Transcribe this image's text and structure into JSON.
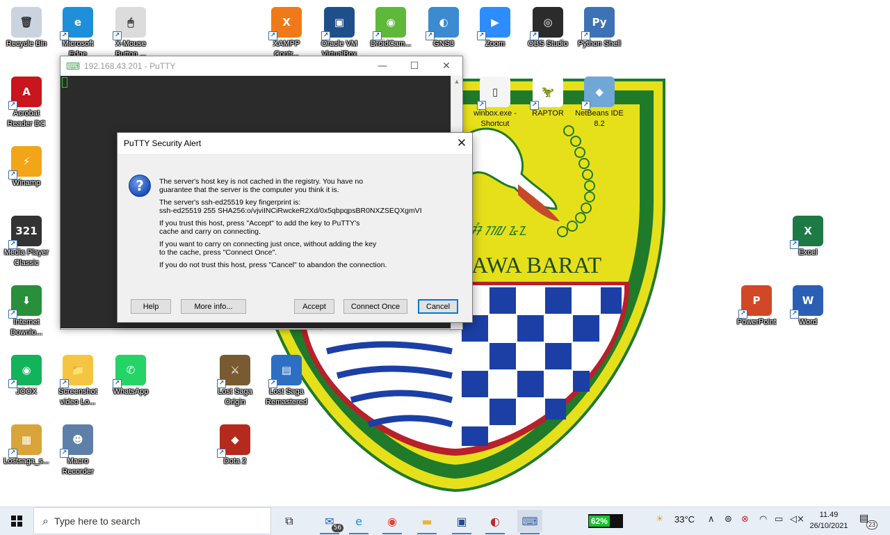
{
  "desktop_icons": [
    {
      "id": "recycle-bin",
      "label": "Recycle Bin",
      "glyph": "🗑",
      "color": "#c9d4de"
    },
    {
      "id": "microsoft-edge",
      "label": "Microsoft Edge",
      "glyph": "e",
      "color": "#1e8fd8"
    },
    {
      "id": "x-mouse",
      "label": "X-Mouse Button ...",
      "glyph": "🖱",
      "color": "#dcdcdc"
    },
    {
      "id": "xampp",
      "label": "XAMPP Contr...",
      "glyph": "X",
      "color": "#f07a18"
    },
    {
      "id": "virtualbox",
      "label": "Oracle VM VirtualBox",
      "glyph": "▣",
      "color": "#1f4f8a"
    },
    {
      "id": "droidcam",
      "label": "DroidCam...",
      "glyph": "◉",
      "color": "#5fb83a"
    },
    {
      "id": "gns3",
      "label": "GNS3",
      "glyph": "◐",
      "color": "#3a8bcf"
    },
    {
      "id": "zoom",
      "label": "Zoom",
      "glyph": "▶",
      "color": "#2d8cff"
    },
    {
      "id": "obs",
      "label": "OBS Studio",
      "glyph": "◎",
      "color": "#2b2b2b"
    },
    {
      "id": "python-shell",
      "label": "Python Shell",
      "glyph": "Py",
      "color": "#3d72b4"
    },
    {
      "id": "acrobat",
      "label": "Acrobat Reader DC",
      "glyph": "A",
      "color": "#c9151e"
    },
    {
      "id": "winamp",
      "label": "Winamp",
      "glyph": "⚡",
      "color": "#f2a516"
    },
    {
      "id": "mpc",
      "label": "Media Player Classic",
      "glyph": "321",
      "color": "#333333"
    },
    {
      "id": "idm",
      "label": "Internet Downlo...",
      "glyph": "⬇",
      "color": "#2a8f3a"
    },
    {
      "id": "joox",
      "label": "JOOX",
      "glyph": "◉",
      "color": "#12b35b"
    },
    {
      "id": "screenshot-folder",
      "label": "Screenshot video Lo...",
      "glyph": "📁",
      "color": "#f5c542"
    },
    {
      "id": "whatsapp",
      "label": "WhatsApp",
      "glyph": "✆",
      "color": "#25d366"
    },
    {
      "id": "lostsaga-origin",
      "label": "Lost Saga Origin",
      "glyph": "⚔",
      "color": "#7a5a30"
    },
    {
      "id": "lostsaga-remastered",
      "label": "Lost Saga Remastered",
      "glyph": "▤",
      "color": "#2d6fc2"
    },
    {
      "id": "lostsaga-s",
      "label": "Lostsaga_s...",
      "glyph": "▦",
      "color": "#d9a43a"
    },
    {
      "id": "macro-recorder",
      "label": "Macro Recorder",
      "glyph": "☻",
      "color": "#5d7fa8"
    },
    {
      "id": "dota2",
      "label": "Dota 2",
      "glyph": "◆",
      "color": "#b52a1c"
    },
    {
      "id": "winbox",
      "label": "winbox.exe - Shortcut",
      "glyph": "▯",
      "color": "#f5f5f5"
    },
    {
      "id": "raptor",
      "label": "RAPTOR",
      "glyph": "🦖",
      "color": "#ffffff"
    },
    {
      "id": "netbeans",
      "label": "NetBeans IDE 8.2",
      "glyph": "◆",
      "color": "#6fa7d6"
    },
    {
      "id": "excel",
      "label": "Excel",
      "glyph": "X",
      "color": "#1d7a45"
    },
    {
      "id": "powerpoint",
      "label": "PowerPoint",
      "glyph": "P",
      "color": "#d24726"
    },
    {
      "id": "word",
      "label": "Word",
      "glyph": "W",
      "color": "#2b5fb6"
    }
  ],
  "wallpaper_text": "AWA BARAT",
  "putty": {
    "title": "192.168.43.201 - PuTTY",
    "minimize": "—",
    "maximize": "☐",
    "close": "✕"
  },
  "alert": {
    "title": "PuTTY Security Alert",
    "close": "✕",
    "icon": "?",
    "paragraphs": [
      "The server's host key is not cached in the registry. You have no\nguarantee that the server is the computer you think it is.",
      "The server's ssh-ed25519 key fingerprint is:\nssh-ed25519 255 SHA256:o/vjviINCiRwckeR2Xd/0x5qbpqpsBR0NXZSEQXgmVI",
      "If you trust this host, press \"Accept\" to add the key to PuTTY's\ncache and carry on connecting.",
      "If you want to carry on connecting just once, without adding the key\nto the cache, press \"Connect Once\".",
      "If you do not trust this host, press \"Cancel\" to abandon the connection."
    ],
    "buttons": {
      "help": "Help",
      "more_info": "More info...",
      "accept": "Accept",
      "connect_once": "Connect Once",
      "cancel": "Cancel"
    }
  },
  "taskbar": {
    "start_icon": "windows-logo",
    "search_placeholder": "Type here to search",
    "search_icon": "⌕",
    "apps": [
      {
        "id": "task-view",
        "glyph": "⧉",
        "color": "#222"
      },
      {
        "id": "mail",
        "glyph": "✉",
        "color": "#1f5fb5",
        "badge": "56"
      },
      {
        "id": "edge",
        "glyph": "e",
        "color": "#1e8fd8"
      },
      {
        "id": "chrome",
        "glyph": "◉",
        "color": "#e0443a"
      },
      {
        "id": "file-explorer",
        "glyph": "▬",
        "color": "#e8b53a"
      },
      {
        "id": "virtualbox",
        "glyph": "▣",
        "color": "#1f4f8a"
      },
      {
        "id": "gns3",
        "glyph": "◐",
        "color": "#c0282b"
      },
      {
        "id": "putty",
        "glyph": "⌨",
        "color": "#3a5fa5"
      }
    ],
    "battery_percent": 62,
    "battery_label": "62%",
    "weather": "33°C",
    "weather_icon": "☀",
    "time": "11.49",
    "date": "26/10/2021",
    "notifications": "23",
    "tray_icons": [
      "∧",
      "⊚",
      "⊗",
      "◠",
      "▭",
      "◁×"
    ]
  },
  "colors": {
    "wallpaper_green": "#1f7a2a",
    "wallpaper_yellow": "#e6e01a",
    "wallpaper_blue": "#1b3fa5",
    "accent": "#0078d7"
  }
}
